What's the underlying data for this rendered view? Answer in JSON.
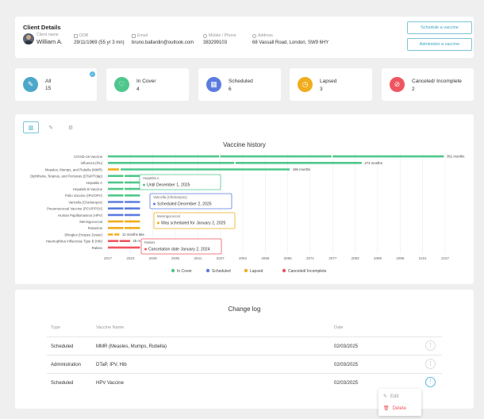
{
  "client": {
    "title": "Client Details",
    "name_label": "Client name",
    "name": "William A.",
    "dob_label": "DOB",
    "dob": "29/11/1969 (55 yr 3 mn)",
    "email_label": "Email",
    "email": "bruno.ballardin@outlook.com",
    "phone_label": "Mobile / Phone",
    "phone": "383299103",
    "address_label": "Address",
    "address": "68 Vassall Road, London, SW9 6HY",
    "schedule_btn": "Schedule a vaccine",
    "administer_btn": "Administer a vaccine"
  },
  "stats": [
    {
      "label": "All",
      "count": "15",
      "color": "#4da7c9",
      "icon": "syringe-icon"
    },
    {
      "label": "In Cover",
      "count": "4",
      "color": "#4fc78c",
      "icon": "heart-icon"
    },
    {
      "label": "Scheduled",
      "count": "6",
      "color": "#5b7be0",
      "icon": "calendar-icon"
    },
    {
      "label": "Lapsed",
      "count": "3",
      "color": "#f0ad1d",
      "icon": "clock-icon"
    },
    {
      "label": "Canceled/ Incomplete",
      "count": "2",
      "color": "#ef5560",
      "icon": "cancel-icon"
    }
  ],
  "chart_data": {
    "type": "bar",
    "title": "Vaccine history",
    "x_ticks": [
      "2017",
      "2023",
      "2029",
      "2035",
      "2041",
      "2047",
      "2053",
      "2059",
      "2065",
      "2071",
      "2077",
      "2083",
      "2089",
      "2095",
      "2101",
      "2107"
    ],
    "categories": [
      "COVID-19 Vaccine",
      "Influenza (Flu)",
      "Measles, Mumps, and Rubella (MMR)",
      "Diphtheria, Tetanus, and Pertussis (DTaP/Tdap)",
      "Hepatitis A",
      "Hepatitis B Vaccine",
      "Polio Vaccine (IPV/OPV)",
      "Varicella (Chickenpox)",
      "Pneumococcal Vaccine (PCV/PPSV)",
      "Human Papillomavirus (HPV)",
      "Meningococcal",
      "Rotavirus",
      "Shingles (Herpes Zoster)",
      "Haemophilus Influenzae Type B (Hib)",
      "Rabies"
    ],
    "series": [
      {
        "name": "In Cover",
        "color": "#4fc78c"
      },
      {
        "name": "Scheduled",
        "color": "#5b7be0"
      },
      {
        "name": "Lapsed",
        "color": "#f0ad1d"
      },
      {
        "name": "Canceled/ Incomplete",
        "color": "#ef5560"
      }
    ],
    "bars": [
      {
        "status": "In Cover",
        "months": 361,
        "label": "361 months",
        "segments": 3
      },
      {
        "status": "In Cover",
        "months": 273,
        "label": "273 months",
        "segments": 2
      },
      {
        "status": "In Cover",
        "months": 196,
        "label": "196 months",
        "lead_lapsed": true,
        "segments": 1
      },
      {
        "status": "In Cover",
        "months": 0,
        "segments": 2
      },
      {
        "status": "In Cover",
        "months": 0,
        "segments": 2
      },
      {
        "status": "In Cover",
        "months": 0,
        "segments": 2
      },
      {
        "status": "In Cover",
        "months": 0,
        "segments": 2
      },
      {
        "status": "Scheduled",
        "months": 0,
        "segments": 2
      },
      {
        "status": "Scheduled",
        "months": 0,
        "segments": 2
      },
      {
        "status": "Scheduled",
        "months": 0,
        "segments": 2
      },
      {
        "status": "Lapsed",
        "months": 0,
        "segments": 2
      },
      {
        "status": "Lapsed",
        "months": 0,
        "segments": 2
      },
      {
        "status": "Lapsed",
        "months": 11,
        "label": "11 months late",
        "segments": 2
      },
      {
        "status": "Canceled/ Incomplete",
        "months": 25,
        "label": "25 m",
        "segments": 2
      },
      {
        "status": "Canceled/ Incomplete",
        "months": 0,
        "segments": 1
      }
    ],
    "tooltips": [
      {
        "name": "Hepatitis A",
        "text": "Until December 1, 2025",
        "status": "In Cover"
      },
      {
        "name": "Varicella (Chickenpox)",
        "text": "Scheduled December 2, 2025",
        "status": "Scheduled"
      },
      {
        "name": "Meningococcal",
        "text": "Was scheduled for January 2, 2025",
        "status": "Lapsed"
      },
      {
        "name": "Rabies",
        "text": "Cancelation date January 2, 2024",
        "status": "Canceled/ Incomplete"
      }
    ]
  },
  "changelog": {
    "title": "Change log",
    "headers": {
      "type": "Type",
      "vaccine": "Vaccine Name",
      "date": "Date"
    },
    "rows": [
      {
        "type": "Scheduled",
        "vaccine": "MMR (Measles, Mumps, Rubella)",
        "date": "02/03/2025"
      },
      {
        "type": "Administration",
        "vaccine": "DTaP, IPV, Hib",
        "date": "02/03/2025"
      },
      {
        "type": "Scheduled",
        "vaccine": "HPV Vaccine",
        "date": "02/03/2025"
      }
    ],
    "menu": {
      "edit": "Edit",
      "delete": "Delete"
    }
  }
}
